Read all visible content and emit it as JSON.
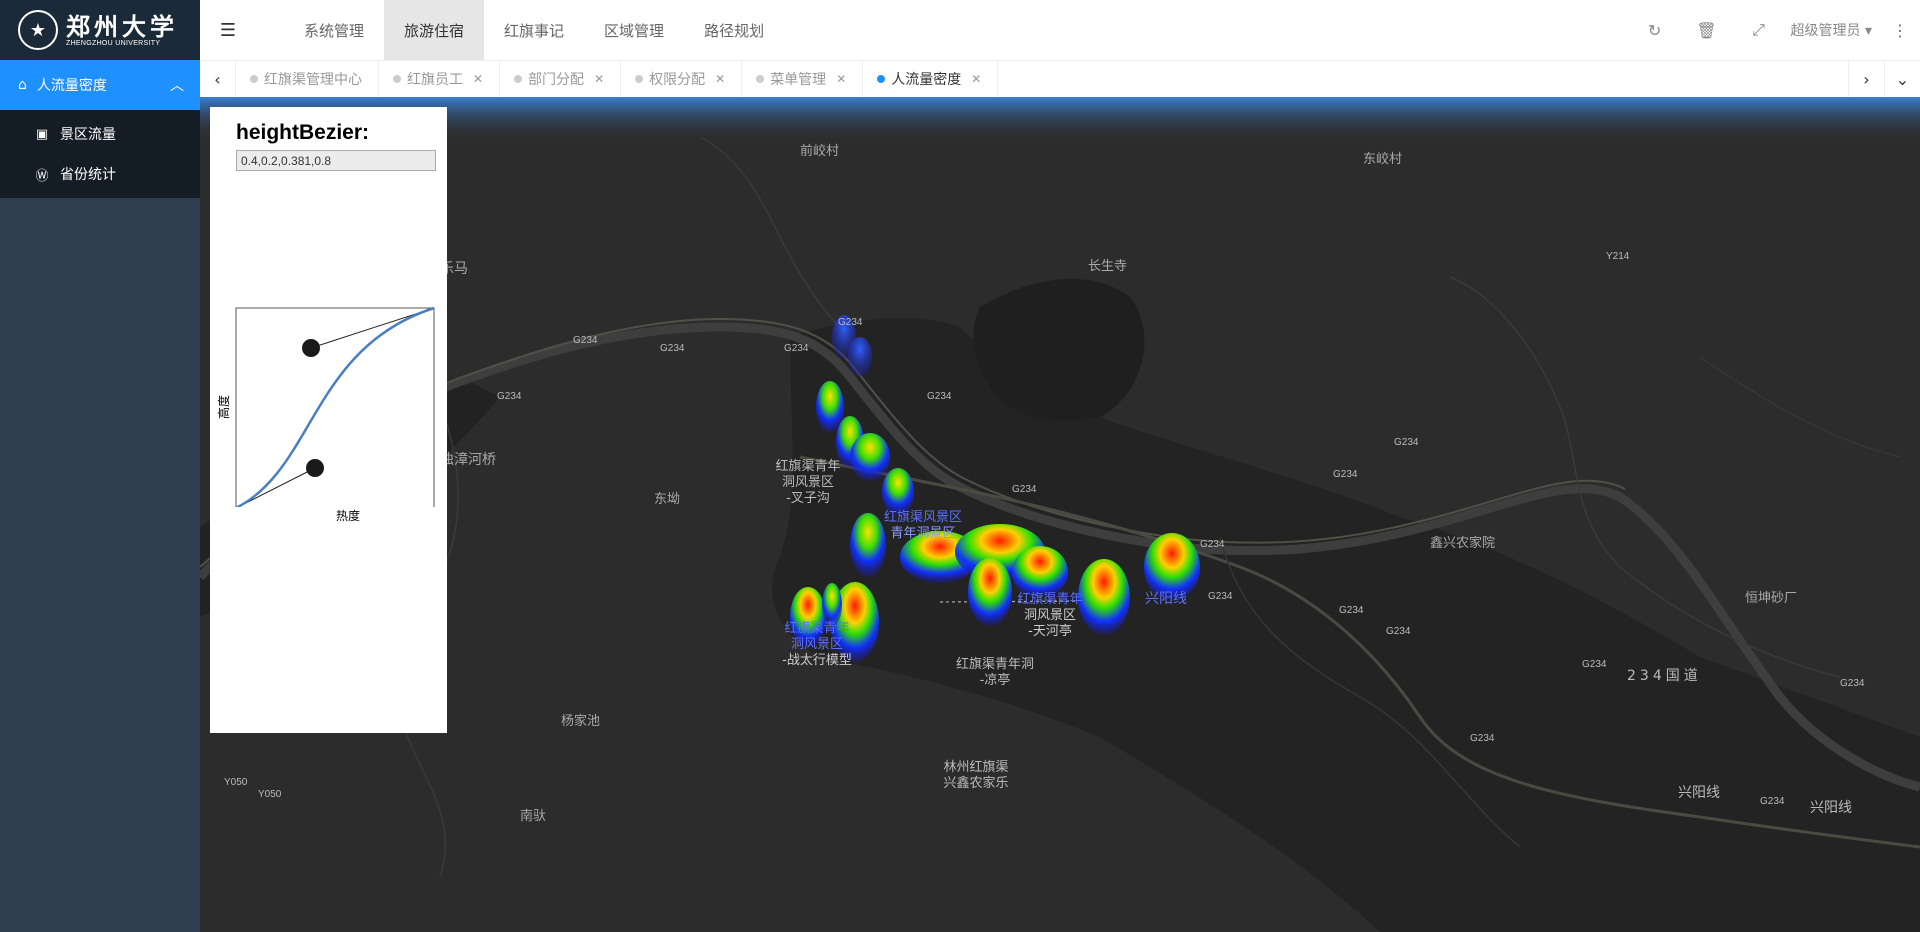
{
  "logo": {
    "cn": "郑州大学",
    "en": "ZHENGZHOU UNIVERSITY"
  },
  "sidebar": {
    "active": {
      "label": "人流量密度",
      "icon": "home-icon"
    },
    "items": [
      {
        "label": "景区流量",
        "icon": "train-icon"
      },
      {
        "label": "省份统计",
        "icon": "wordpress-icon"
      }
    ]
  },
  "header": {
    "nav": [
      "系统管理",
      "旅游住宿",
      "红旗事记",
      "区域管理",
      "路径规划"
    ],
    "active_nav": "旅游住宿",
    "user": "超级管理员"
  },
  "tabs": [
    {
      "label": "红旗渠管理中心",
      "closable": false,
      "active": false
    },
    {
      "label": "红旗员工",
      "closable": true,
      "active": false
    },
    {
      "label": "部门分配",
      "closable": true,
      "active": false
    },
    {
      "label": "权限分配",
      "closable": true,
      "active": false
    },
    {
      "label": "菜单管理",
      "closable": true,
      "active": false
    },
    {
      "label": "人流量密度",
      "closable": true,
      "active": true
    }
  ],
  "bezier": {
    "title": "heightBezier:",
    "value": "0.4,0.2,0.381,0.8",
    "ylabel": "高度",
    "xlabel": "热度"
  },
  "map": {
    "labels": [
      {
        "text": "前峧村"
      },
      {
        "text": "东峧村"
      },
      {
        "text": "长生寺"
      },
      {
        "text": "东坳"
      },
      {
        "text": "杨家池"
      },
      {
        "text": "南驮"
      },
      {
        "text": "鑫兴农家院"
      },
      {
        "text": "恒坤砂厂"
      },
      {
        "text": "浊漳河桥"
      },
      {
        "text": "乐马"
      }
    ],
    "road_labels": [
      "G234",
      "Y214",
      "Y050",
      "兴阳线",
      "234国道"
    ],
    "spot_labels": [
      {
        "lines": [
          "红旗渠青年",
          "洞风景区",
          "-叉子沟"
        ]
      },
      {
        "lines": [
          "红旗渠风景区",
          "青年洞景区"
        ]
      },
      {
        "lines": [
          "红旗渠青年",
          "洞风景区",
          "-战太行模型"
        ]
      },
      {
        "lines": [
          "红旗渠青年",
          "洞风景区",
          "-天河亭"
        ]
      },
      {
        "lines": [
          "红旗渠青年洞",
          "-凉亭"
        ]
      },
      {
        "lines": [
          "林州红旗渠",
          "兴鑫农家乐"
        ]
      }
    ]
  },
  "colors": {
    "accent": "#1e90ff",
    "sidebar": "#2f3e4e",
    "map_bg": "#2d2d2d"
  }
}
